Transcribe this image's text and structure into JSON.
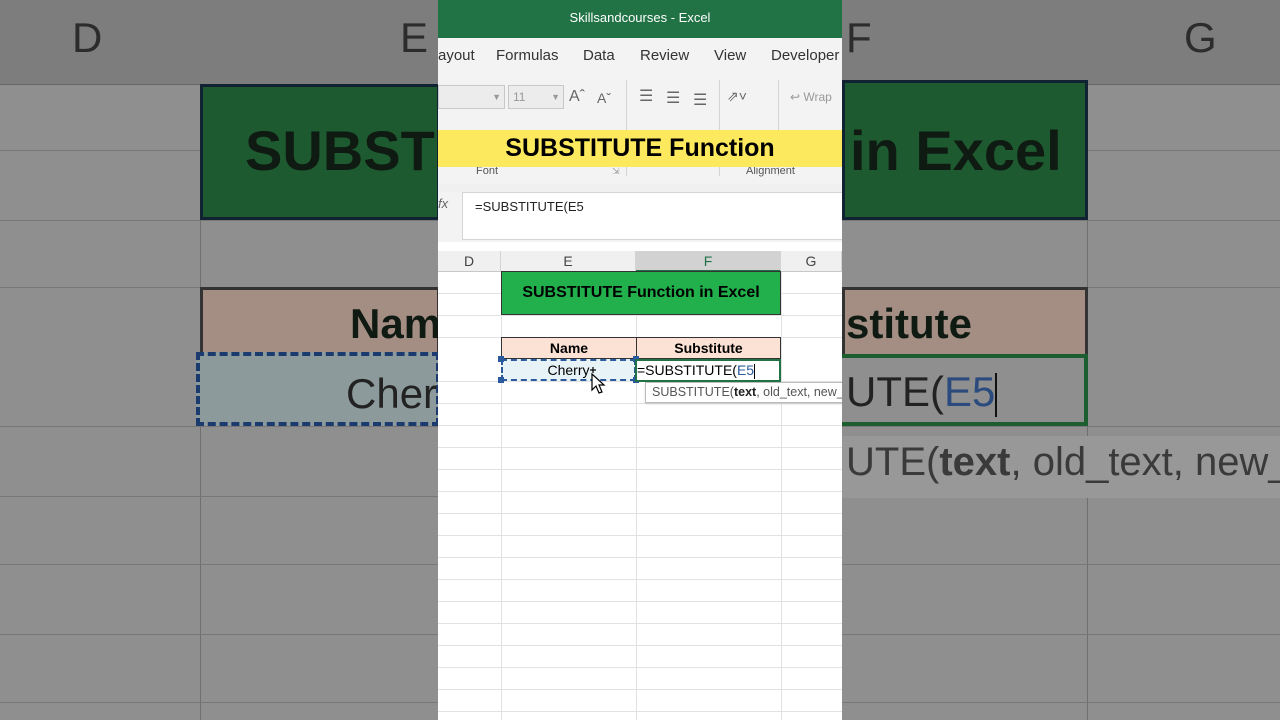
{
  "window": {
    "title": "Skillsandcourses  -  Excel"
  },
  "menu": {
    "items": [
      "ayout",
      "Formulas",
      "Data",
      "Review",
      "View",
      "Developer"
    ]
  },
  "ribbon": {
    "font_size": "11",
    "wrap_label": "Wrap",
    "groups": [
      "Font",
      "Alignment"
    ]
  },
  "banner": {
    "text": "SUBSTITUTE Function"
  },
  "formula_bar": {
    "fx": "fx",
    "value": "=SUBSTITUTE(E5"
  },
  "columns": [
    "D",
    "E",
    "F",
    "G"
  ],
  "sheet": {
    "title": "SUBSTITUTE Function in Excel",
    "headers": [
      "Name",
      "Substitute"
    ],
    "name_value": "Cherry",
    "edit_prefix": "=SUBSTITUTE(",
    "edit_ref": "E5",
    "tooltip_fn": "SUBSTITUTE(",
    "tooltip_arg": "text",
    "tooltip_rest": ", old_text, new_"
  },
  "background": {
    "col_letters": [
      "D",
      "E",
      "F",
      "G"
    ],
    "title_left": "SUBSTIT",
    "title_right": "in Excel",
    "hdr_left": "Nam",
    "hdr_right": "stitute",
    "name_left": "Cher",
    "edit_right": "UTE(",
    "edit_right_ref": "E5",
    "tip_right_pre": "UTE(",
    "tip_right_bold": "text",
    "tip_right_rest": ", old_text, new_"
  },
  "colors": {
    "excel_green": "#217346",
    "title_fill": "#21b04b",
    "header_fill": "#fbe2d5",
    "banner": "#fde95d"
  }
}
